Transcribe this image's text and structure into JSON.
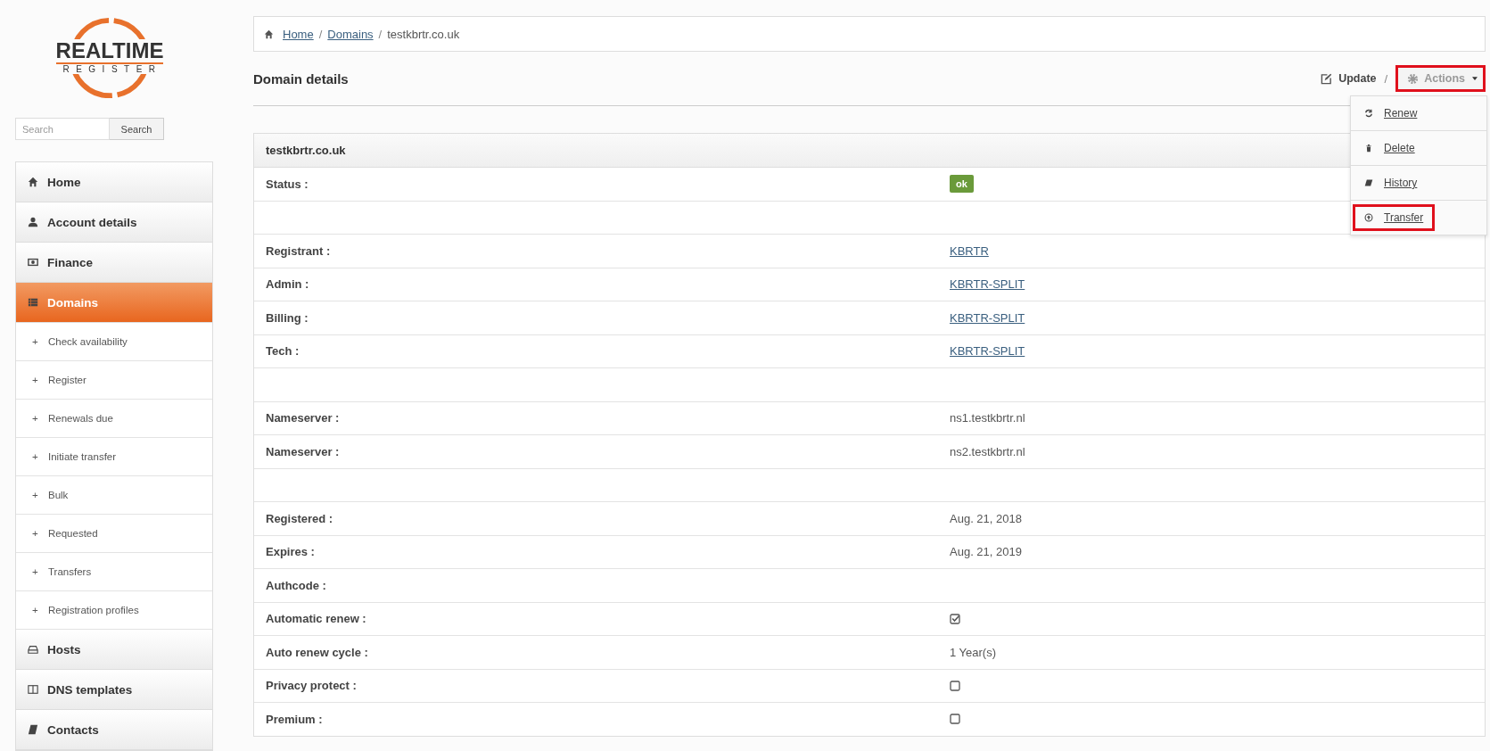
{
  "logo": {
    "word": "REALTIME",
    "subword": "REGISTER"
  },
  "search": {
    "placeholder": "Search",
    "button": "Search"
  },
  "sidebar": {
    "items": [
      {
        "label": "Home",
        "selected": false
      },
      {
        "label": "Account details",
        "selected": false
      },
      {
        "label": "Finance",
        "selected": false
      },
      {
        "label": "Domains",
        "selected": true,
        "children": [
          {
            "bullet": "+",
            "label": "Check availability"
          },
          {
            "bullet": "+",
            "label": "Register"
          },
          {
            "bullet": "+",
            "label": "Renewals due"
          },
          {
            "bullet": "+",
            "label": "Initiate transfer"
          },
          {
            "bullet": "+",
            "label": "Bulk"
          },
          {
            "bullet": "+",
            "label": "Requested"
          },
          {
            "bullet": "+",
            "label": "Transfers"
          },
          {
            "bullet": "+",
            "label": "Registration profiles"
          }
        ]
      },
      {
        "label": "Hosts",
        "selected": false
      },
      {
        "label": "DNS templates",
        "selected": false
      },
      {
        "label": "Contacts",
        "selected": false
      }
    ]
  },
  "breadcrumb": [
    {
      "label": "Home",
      "link": true,
      "separator": "/"
    },
    {
      "label": "Domains",
      "link": true,
      "separator": "/"
    },
    {
      "label": "testkbrtr.co.uk",
      "link": false
    }
  ],
  "page_title": "Domain details",
  "toolbar": {
    "update": "Update",
    "separator": "/",
    "actions": {
      "label": "Actions",
      "expanded": true,
      "highlighted": true
    }
  },
  "actions_menu": [
    {
      "label": "Renew",
      "highlighted": false
    },
    {
      "label": "Delete",
      "highlighted": false
    },
    {
      "label": "History",
      "highlighted": false
    },
    {
      "label": "Transfer",
      "highlighted": true
    }
  ],
  "panel": {
    "title": "testkbrtr.co.uk",
    "rows": [
      {
        "kind": "badge",
        "label": "Status :",
        "value": "ok"
      },
      {
        "kind": "spacer"
      },
      {
        "kind": "link",
        "label": "Registrant :",
        "value": "KBRTR"
      },
      {
        "kind": "link",
        "label": "Admin :",
        "value": "KBRTR-SPLIT"
      },
      {
        "kind": "link",
        "label": "Billing :",
        "value": "KBRTR-SPLIT"
      },
      {
        "kind": "link",
        "label": "Tech :",
        "value": "KBRTR-SPLIT"
      },
      {
        "kind": "spacer"
      },
      {
        "kind": "text",
        "label": "Nameserver :",
        "value": "ns1.testkbrtr.nl"
      },
      {
        "kind": "text",
        "label": "Nameserver :",
        "value": "ns2.testkbrtr.nl"
      },
      {
        "kind": "spacer"
      },
      {
        "kind": "text",
        "label": "Registered :",
        "value": "Aug. 21, 2018"
      },
      {
        "kind": "text",
        "label": "Expires :",
        "value": "Aug. 21, 2019"
      },
      {
        "kind": "text",
        "label": "Authcode :"
      },
      {
        "kind": "checkbox",
        "label": "Automatic renew :",
        "checked": true
      },
      {
        "kind": "text",
        "label": "Auto renew cycle :",
        "value": "1 Year(s)"
      },
      {
        "kind": "checkbox",
        "label": "Privacy protect :",
        "checked": false
      },
      {
        "kind": "checkbox",
        "label": "Premium :",
        "checked": false
      }
    ]
  }
}
